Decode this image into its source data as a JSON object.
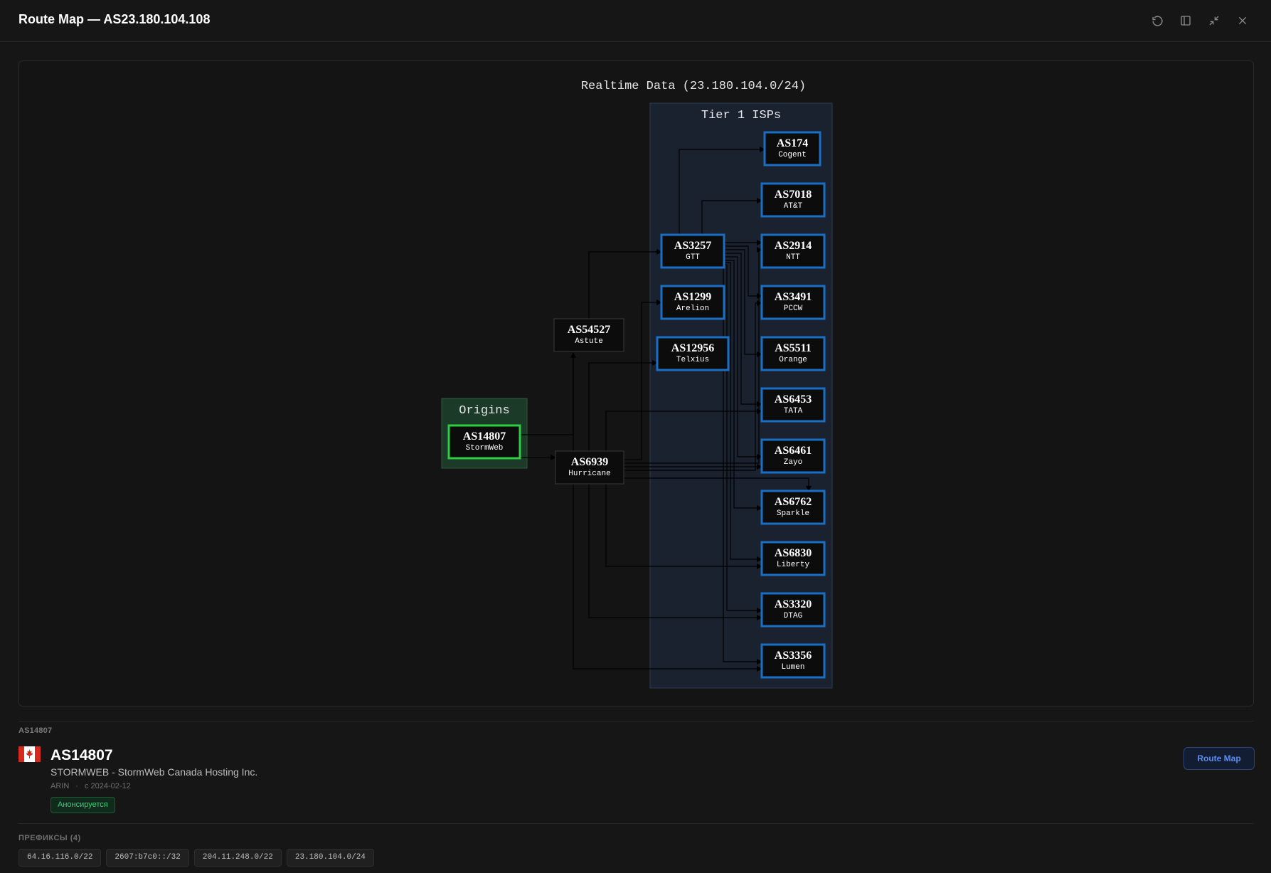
{
  "window": {
    "title": "Route Map — AS23.180.104.108",
    "controls": [
      "refresh-icon",
      "split-view-icon",
      "minimize-icon",
      "close-icon"
    ]
  },
  "graph": {
    "title": "Realtime Data (23.180.104.0/24)",
    "clusters": {
      "origins": "Origins",
      "tier1": "Tier 1 ISPs"
    },
    "colors": {
      "origin_border": "#2ecc40",
      "tier1_border": "#1a6fc4",
      "origin_fill": "#1b3a28",
      "tier1_fill": "#1a2230",
      "node_fill": "#0c0c0c",
      "edge": "#000000"
    },
    "nodes": {
      "AS14807": {
        "asn": "AS14807",
        "name": "StormWeb"
      },
      "AS54527": {
        "asn": "AS54527",
        "name": "Astute"
      },
      "AS6939": {
        "asn": "AS6939",
        "name": "Hurricane"
      },
      "AS3257": {
        "asn": "AS3257",
        "name": "GTT"
      },
      "AS1299": {
        "asn": "AS1299",
        "name": "Arelion"
      },
      "AS12956": {
        "asn": "AS12956",
        "name": "Telxius"
      },
      "AS174": {
        "asn": "AS174",
        "name": "Cogent"
      },
      "AS7018": {
        "asn": "AS7018",
        "name": "AT&T"
      },
      "AS2914": {
        "asn": "AS2914",
        "name": "NTT"
      },
      "AS3491": {
        "asn": "AS3491",
        "name": "PCCW"
      },
      "AS5511": {
        "asn": "AS5511",
        "name": "Orange"
      },
      "AS6453": {
        "asn": "AS6453",
        "name": "TATA"
      },
      "AS6461": {
        "asn": "AS6461",
        "name": "Zayo"
      },
      "AS6762": {
        "asn": "AS6762",
        "name": "Sparkle"
      },
      "AS6830": {
        "asn": "AS6830",
        "name": "Liberty"
      },
      "AS3320": {
        "asn": "AS3320",
        "name": "DTAG"
      },
      "AS3356": {
        "asn": "AS3356",
        "name": "Lumen"
      }
    }
  },
  "details": {
    "section_label": "AS14807",
    "asn": "AS14807",
    "org": "STORMWEB - StormWeb Canada Hosting Inc.",
    "registry": "ARIN",
    "since": "с 2024-02-12",
    "status": "Анонсируется",
    "route_map_button": "Route Map",
    "flag_icon": "canada-flag-icon"
  },
  "prefixes": {
    "label": "ПРЕФИКСЫ (4)",
    "items": [
      "64.16.116.0/22",
      "2607:b7c0::/32",
      "204.11.248.0/22",
      "23.180.104.0/24"
    ]
  }
}
